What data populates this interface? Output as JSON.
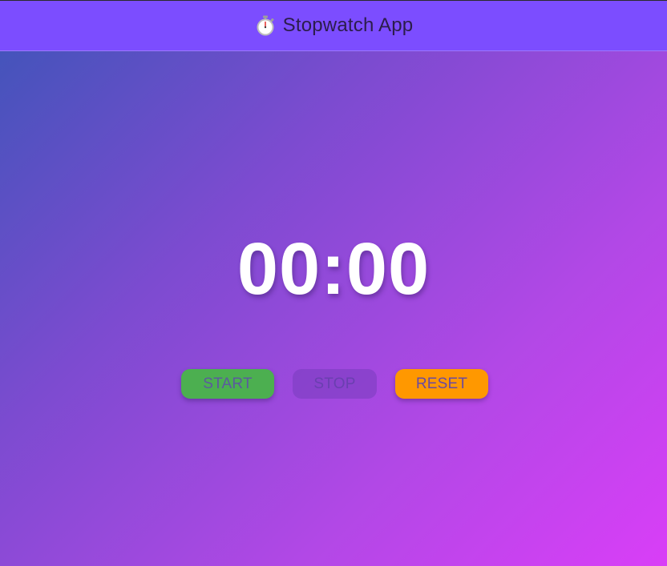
{
  "appbar": {
    "title": "Stopwatch App",
    "icon": "stopwatch-icon",
    "background": "#7c4dff"
  },
  "timer": {
    "display": "00:00"
  },
  "controls": {
    "start_label": "START",
    "stop_label": "STOP",
    "reset_label": "RESET",
    "start_color": "#4caf50",
    "reset_color": "#ff9800"
  }
}
